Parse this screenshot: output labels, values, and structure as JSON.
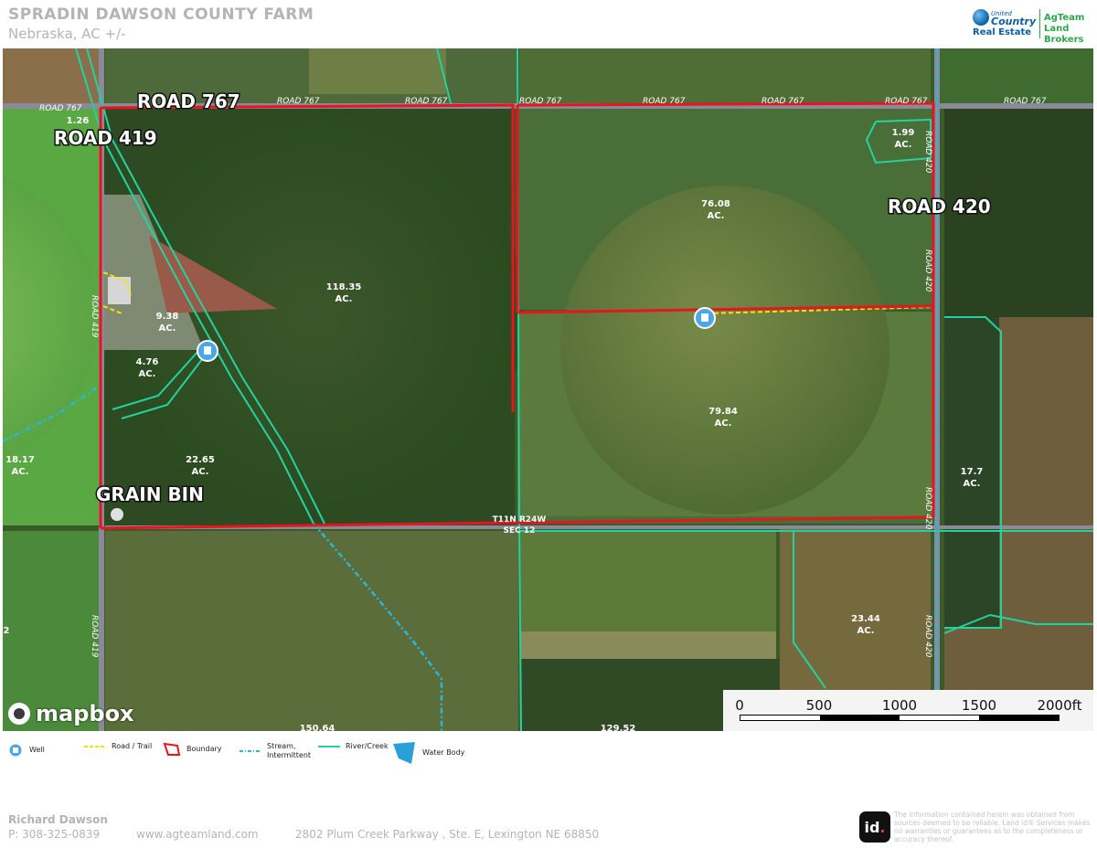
{
  "header": {
    "title": "SPRADIN DAWSON COUNTY FARM",
    "subtitle": "Nebraska,  AC +/-",
    "logo_uc_line1": "United",
    "logo_uc_line2": "Country",
    "logo_uc_line3": "Real Estate",
    "logo_ag_line1": "AgTeam",
    "logo_ag_line2": "Land Brokers"
  },
  "map": {
    "big_labels": [
      "ROAD 767",
      "ROAD 419",
      "ROAD 420",
      "GRAIN BIN"
    ],
    "small_road_labels": [
      "ROAD 767",
      "ROAD 767",
      "ROAD 767",
      "ROAD 767",
      "ROAD 767",
      "ROAD 767",
      "ROAD 767",
      "ROAD 767",
      "ROAD 420",
      "ROAD 420",
      "ROAD 420",
      "ROAD 420",
      "ROAD 419",
      "ROAD 419"
    ],
    "section_label_1": "T11N R24W",
    "section_label_2": "SEC 12",
    "acreages": [
      {
        "value": "1.26",
        "unit": ""
      },
      {
        "value": "1.99",
        "unit": "AC."
      },
      {
        "value": "76.08",
        "unit": "AC."
      },
      {
        "value": "118.35",
        "unit": "AC."
      },
      {
        "value": "9.38",
        "unit": "AC."
      },
      {
        "value": "4.76",
        "unit": "AC."
      },
      {
        "value": "79.84",
        "unit": "AC."
      },
      {
        "value": "18.17",
        "unit": "AC."
      },
      {
        "value": "22.65",
        "unit": "AC."
      },
      {
        "value": "17.7",
        "unit": "AC."
      },
      {
        "value": "23.44",
        "unit": "AC."
      },
      {
        "value": "150.64",
        "unit": ""
      },
      {
        "value": "129.52",
        "unit": ""
      },
      {
        "value": "2",
        "unit": ""
      }
    ],
    "attribution": "mapbox",
    "scale_labels": [
      "0",
      "500",
      "1000",
      "1500",
      "2000ft"
    ],
    "colors": {
      "boundary": "#e8141e",
      "river": "#22d3a0",
      "stream": "#2cb7d6",
      "road": "#ffe100",
      "well": "#4aa8e8"
    }
  },
  "legend": {
    "well": "Well",
    "road_trail": "Road / Trail",
    "boundary": "Boundary",
    "stream_1": "Stream,",
    "stream_2": "Intermittent",
    "river": "River/Creek",
    "water_body": "Water Body"
  },
  "footer": {
    "name": "Richard Dawson",
    "phone": "P: 308-325-0839",
    "website": "www.agteamland.com",
    "address": "2802 Plum Creek Parkway , Ste. E, Lexington NE 68850",
    "id_logo": "id",
    "disclaimer": "The information contained herein was obtained from sources deemed to be reliable. Land id® Services makes no warranties or guarantees as to the completeness or accuracy thereof."
  }
}
